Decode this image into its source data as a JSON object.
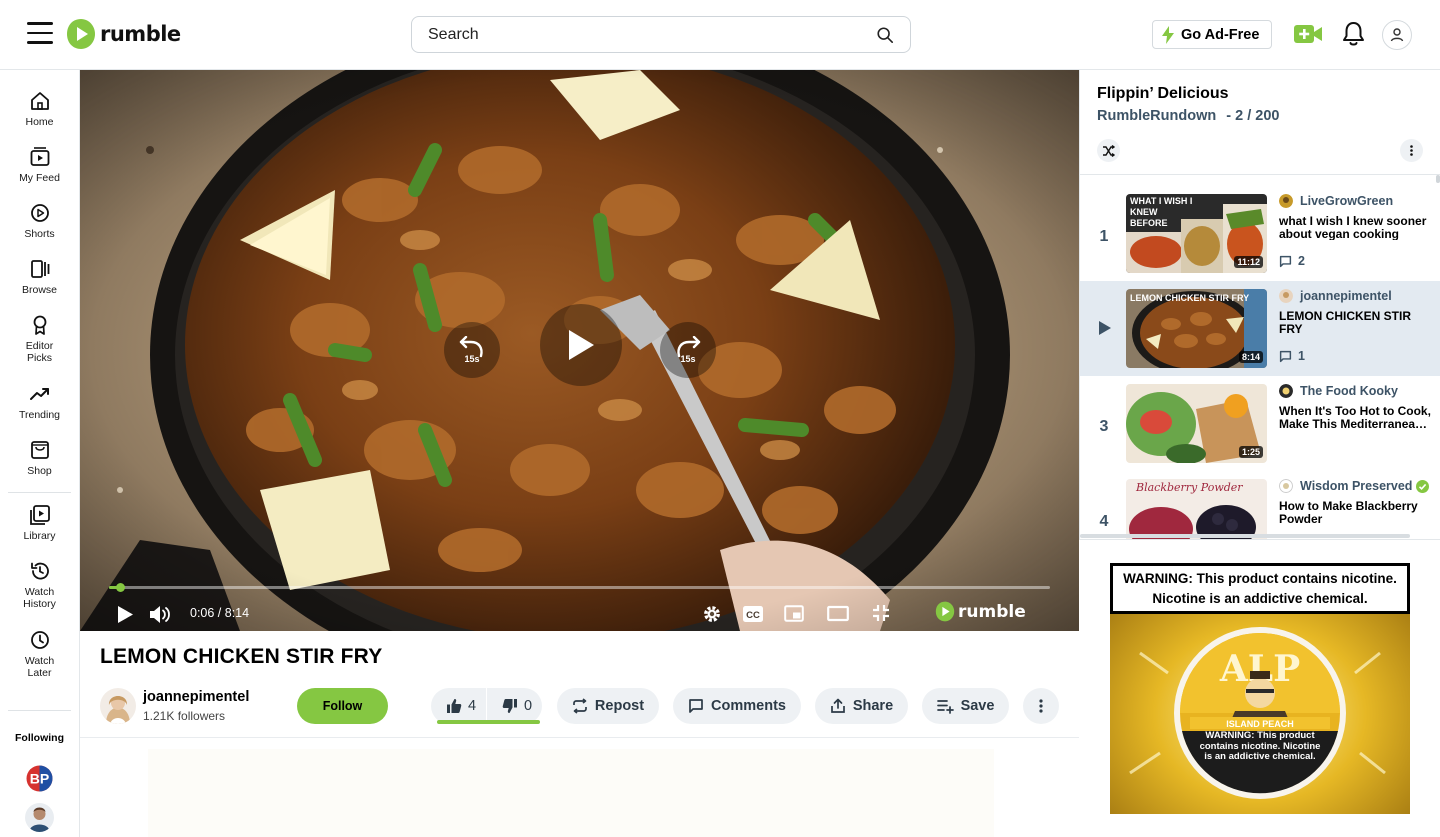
{
  "header": {
    "logo_text": "rumble",
    "search_placeholder": "Search",
    "adfree_label": "Go Ad-Free",
    "brand_color": "#85c742"
  },
  "sidebar": {
    "items": [
      {
        "label": "Home",
        "icon": "home-icon"
      },
      {
        "label": "My Feed",
        "icon": "feed-icon"
      },
      {
        "label": "Shorts",
        "icon": "shorts-icon"
      },
      {
        "label": "Browse",
        "icon": "browse-icon"
      },
      {
        "label": "Editor Picks",
        "icon": "ribbon-icon"
      },
      {
        "label": "Trending",
        "icon": "trending-icon"
      },
      {
        "label": "Shop",
        "icon": "shop-icon"
      },
      {
        "label": "Library",
        "icon": "library-icon"
      },
      {
        "label": "Watch History",
        "icon": "history-icon"
      },
      {
        "label": "Watch Later",
        "icon": "clock-icon"
      }
    ],
    "following_title": "Following",
    "following_avatars": [
      {
        "initials": "BP",
        "color": "#d6322f"
      },
      {
        "initials": "",
        "color": "#6a7c8e"
      }
    ]
  },
  "player": {
    "time": "0:06 / 8:14",
    "progress_fraction": 0.012,
    "skip_back_label": "15s",
    "skip_forward_label": "15s",
    "brand": "rumble"
  },
  "video": {
    "title": "LEMON CHICKEN STIR FRY",
    "channel_name": "joannepimentel",
    "followers": "1.21K followers",
    "follow_label": "Follow",
    "likes": "4",
    "dislikes": "0",
    "repost_label": "Repost",
    "comments_label": "Comments",
    "share_label": "Share",
    "save_label": "Save"
  },
  "playlist": {
    "title": "Flippin’ Delicious",
    "owner": "RumbleRundown",
    "position": "- 2 / 200",
    "items": [
      {
        "index": "1",
        "channel": "LiveGrowGreen",
        "title": "what I wish I knew sooner about vegan cooking",
        "duration": "11:12",
        "comments": "2",
        "thumb_text": "WHAT I WISH I KNEW BEFORE",
        "active": false,
        "verified": false
      },
      {
        "index": "",
        "channel": "joannepimentel",
        "title": "LEMON CHICKEN STIR FRY",
        "duration": "8:14",
        "comments": "1",
        "thumb_text": "LEMON CHICKEN STIR FRY",
        "active": true,
        "verified": false
      },
      {
        "index": "3",
        "channel": "The Food Kooky",
        "title": "When It's Too Hot to Cook, Make This Mediterranea…",
        "duration": "1:25",
        "comments": "",
        "thumb_text": "",
        "active": false,
        "verified": false
      },
      {
        "index": "4",
        "channel": "Wisdom Preserved",
        "title": "How to Make Blackberry Powder",
        "duration": "",
        "comments": "",
        "thumb_text": "Blackberry Powder",
        "active": false,
        "verified": true
      }
    ]
  },
  "ad": {
    "warning_line1": "WARNING: This product contains nicotine.",
    "warning_line2": "Nicotine is an addictive chemical.",
    "brand_text": "ALP",
    "flavor": "ISLAND PEACH",
    "inner_warning": "WARNING: This product contains nicotine. Nicotine is an addictive chemical."
  }
}
